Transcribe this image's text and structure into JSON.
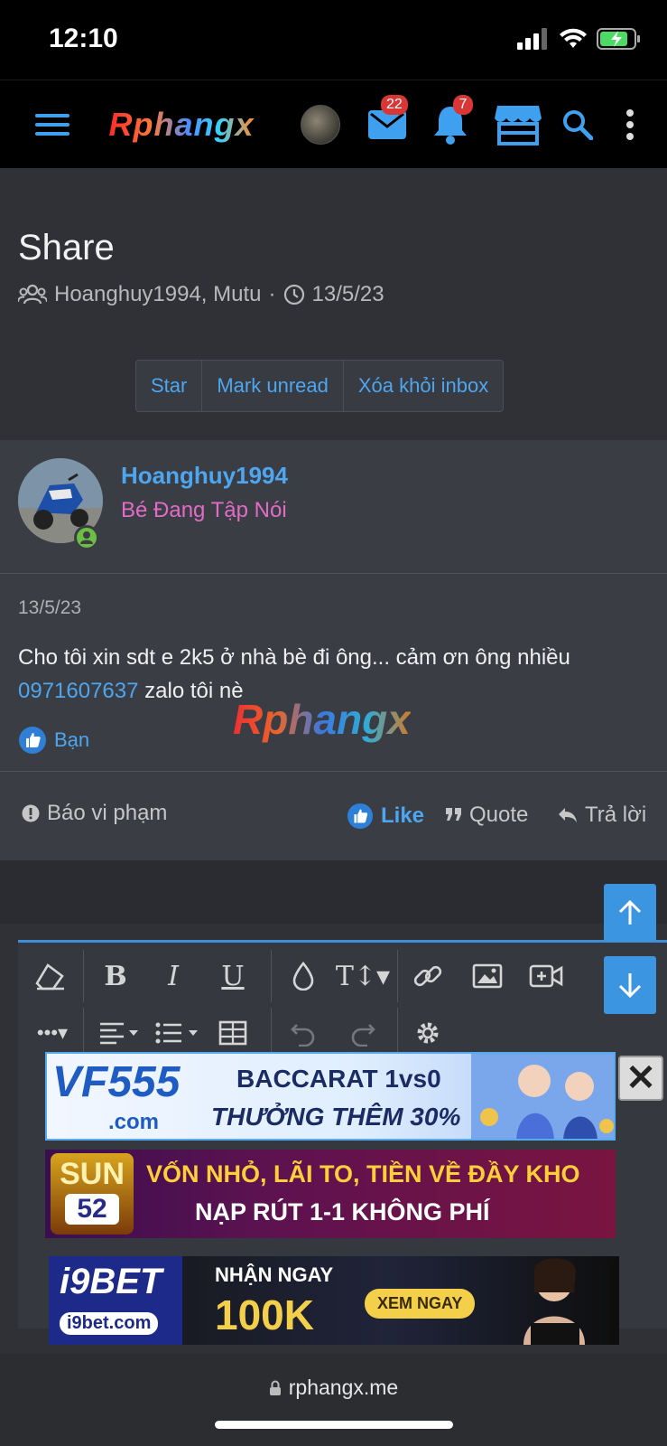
{
  "status": {
    "time": "12:10"
  },
  "nav": {
    "logo": "Rphangx",
    "inbox_count": "22",
    "alerts_count": "7"
  },
  "thread": {
    "title": "Share",
    "participants": "Hoanghuy1994, Mutu",
    "date": "13/5/23",
    "buttons": {
      "star": "Star",
      "mark_unread": "Mark unread",
      "remove": "Xóa khỏi inbox"
    }
  },
  "post": {
    "username": "Hoanghuy1994",
    "user_title": "Bé Đang Tập Nói",
    "date": "13/5/23",
    "text_line1": "Cho tôi xin sdt e 2k5 ở nhà bè đi ông... cảm ơn ông nhiều",
    "phone": "0971607637",
    "text_after_phone": " zalo tôi nè",
    "reaction_user": "Bạn",
    "watermark": "Rphangx",
    "actions": {
      "report": "Báo vi phạm",
      "like": "Like",
      "quote": "Quote",
      "reply": "Trả lời"
    }
  },
  "ads": {
    "ad1": {
      "brand": "VF555",
      "domain": ".com",
      "line1": "BACCARAT 1vs0",
      "line2": "THƯỞNG THÊM 30%"
    },
    "ad2": {
      "brand": "SUN",
      "brand_num": "52",
      "line1": "VỐN NHỎ, LÃI TO, TIỀN VỀ ĐẦY KHO",
      "line2": "NẠP RÚT 1-1 KHÔNG PHÍ"
    },
    "ad3": {
      "brand": "i9BET",
      "domain": "i9bet.com",
      "line1": "NHẬN NGAY",
      "line2": "100K",
      "cta": "XEM NGAY"
    }
  },
  "browser": {
    "url": "rphangx.me"
  },
  "colors": {
    "accent": "#4ea6f0",
    "user_title": "#e06cc6",
    "online": "#6cbf43",
    "badge": "#d93636",
    "float_button": "#3b95e0"
  }
}
